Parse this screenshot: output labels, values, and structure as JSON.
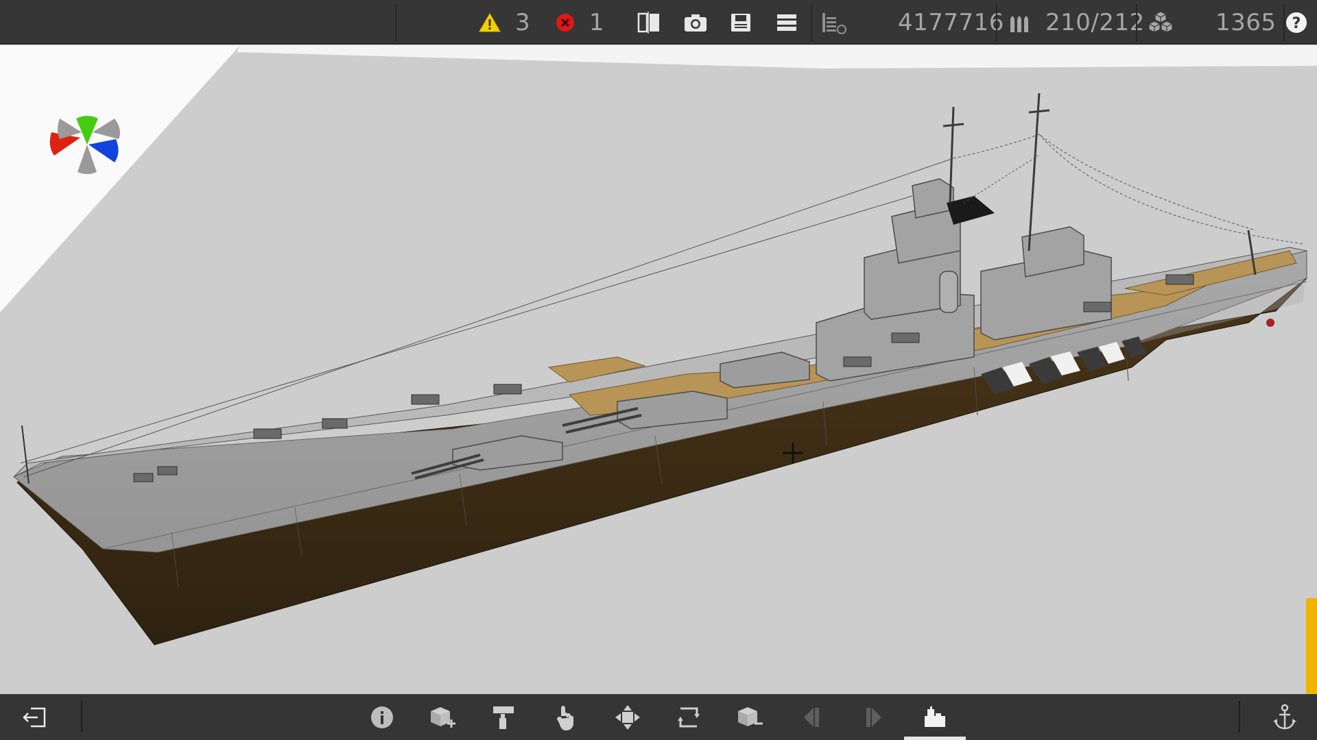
{
  "toolbar": {
    "warnings_count": "3",
    "errors_count": "1",
    "mass_value": "4177716",
    "ammo_value": "210/212",
    "blocks_count": "1365",
    "icons": [
      "warning-icon",
      "error-icon",
      "mirror-icon",
      "camera-icon",
      "save-icon",
      "menu-icon",
      "layers-icon",
      "ammo-icon",
      "blocks-icon",
      "help-icon"
    ]
  },
  "bottom_toolbar": {
    "icons": [
      "exit-icon",
      "info-icon",
      "add-block-icon",
      "paint-roller-icon",
      "select-hand-icon",
      "move-icon",
      "rotate-icon",
      "remove-block-icon",
      "previous-icon",
      "next-icon",
      "build-mode-icon",
      "anchor-icon"
    ],
    "active_tool": "build-mode-icon"
  },
  "viewport": {
    "model": "battleship",
    "colors": {
      "background": "#cdcdcd",
      "hull_upper": "#9a9a9a",
      "hull_lower": "#3a2a14",
      "deck_wood": "#b89556",
      "accent": "#f0b400"
    }
  },
  "orientation_gizmo": {
    "axis_colors": {
      "up": "#44cc11",
      "left": "#dd2211",
      "right": "#1144dd",
      "neutral": "#9a9a9a"
    }
  }
}
